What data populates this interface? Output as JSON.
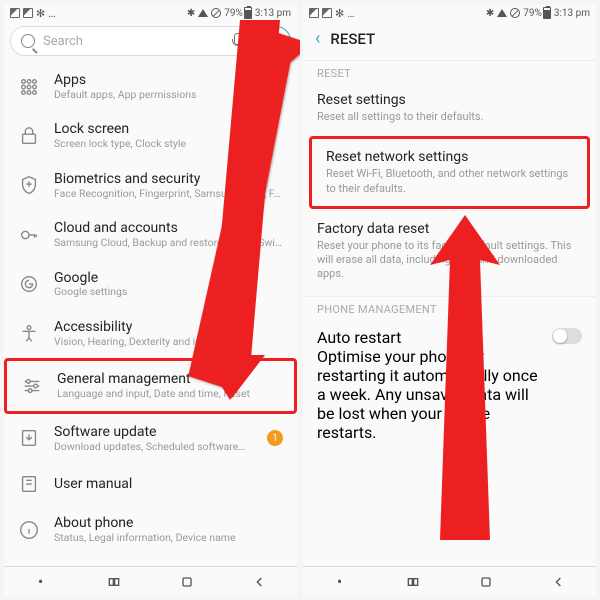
{
  "statusbar": {
    "battery_pct": "79%",
    "time": "3:13 pm"
  },
  "left": {
    "search_placeholder": "Search",
    "items": [
      {
        "title": "Apps",
        "sub": "Default apps, App permissions"
      },
      {
        "title": "Lock screen",
        "sub": "Screen lock type, Clock style"
      },
      {
        "title": "Biometrics and security",
        "sub": "Face Recognition, Fingerprint, Samsung Pass, F…"
      },
      {
        "title": "Cloud and accounts",
        "sub": "Samsung Cloud, Backup and restore, Smart Swi…"
      },
      {
        "title": "Google",
        "sub": "Google settings"
      },
      {
        "title": "Accessibility",
        "sub": "Vision, Hearing, Dexterity and interaction"
      },
      {
        "title": "General management",
        "sub": "Language and input, Date and time, Reset"
      },
      {
        "title": "Software update",
        "sub": "Download updates, Scheduled software…",
        "badge": "1"
      },
      {
        "title": "User manual",
        "sub": ""
      },
      {
        "title": "About phone",
        "sub": "Status, Legal information, Device name"
      }
    ]
  },
  "right": {
    "header": "RESET",
    "section1_label": "RESET",
    "items": [
      {
        "title": "Reset settings",
        "sub": "Reset all settings to their defaults."
      },
      {
        "title": "Reset network settings",
        "sub": "Reset Wi-Fi, Bluetooth, and other network settings to their defaults."
      },
      {
        "title": "Factory data reset",
        "sub": "Reset your phone to its factory default settings. This will erase all data, including files and downloaded apps."
      }
    ],
    "section2_label": "PHONE MANAGEMENT",
    "auto_restart": {
      "title": "Auto restart",
      "sub": "Optimise your phone by restarting it automatically once a week. Any unsaved data will be lost when your phone restarts."
    }
  }
}
